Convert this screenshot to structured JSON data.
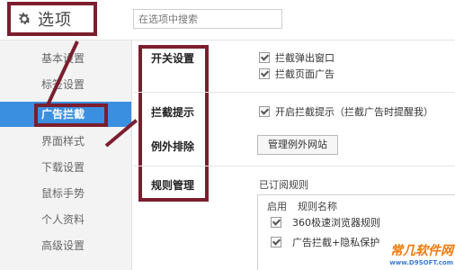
{
  "header": {
    "title": "选项",
    "search_placeholder": "在选项中搜索"
  },
  "sidebar": {
    "items": [
      {
        "label": "基本设置"
      },
      {
        "label": "标签设置"
      },
      {
        "label": "广告拦截",
        "active": true
      },
      {
        "label": "界面样式"
      },
      {
        "label": "下载设置"
      },
      {
        "label": "鼠标手势"
      },
      {
        "label": "个人资料"
      },
      {
        "label": "高级设置"
      }
    ]
  },
  "main": {
    "sections": {
      "switch": "开关设置",
      "prompt": "拦截提示",
      "exceptions": "例外排除",
      "rules": "规则管理"
    },
    "switch_options": [
      {
        "label": "拦截弹出窗口",
        "checked": true
      },
      {
        "label": "拦截页面广告",
        "checked": true
      }
    ],
    "prompt_option": {
      "label": "开启拦截提示（拦截广告时提醒我）",
      "checked": true
    },
    "exceptions_button": "管理例外网站",
    "rules": {
      "subscribed_title": "已订阅规则",
      "col_enable": "启用",
      "col_name": "规则名称",
      "rows": [
        {
          "name": "360极速浏览器规则",
          "checked": true
        },
        {
          "name": "广告拦截+隐私保护",
          "checked": true
        }
      ]
    }
  },
  "colors": {
    "accent": "#3b8fe0",
    "annotation": "#7b1e2e"
  },
  "watermark": {
    "text": "常几软件网",
    "sub": "www.D9SOFT.com"
  }
}
